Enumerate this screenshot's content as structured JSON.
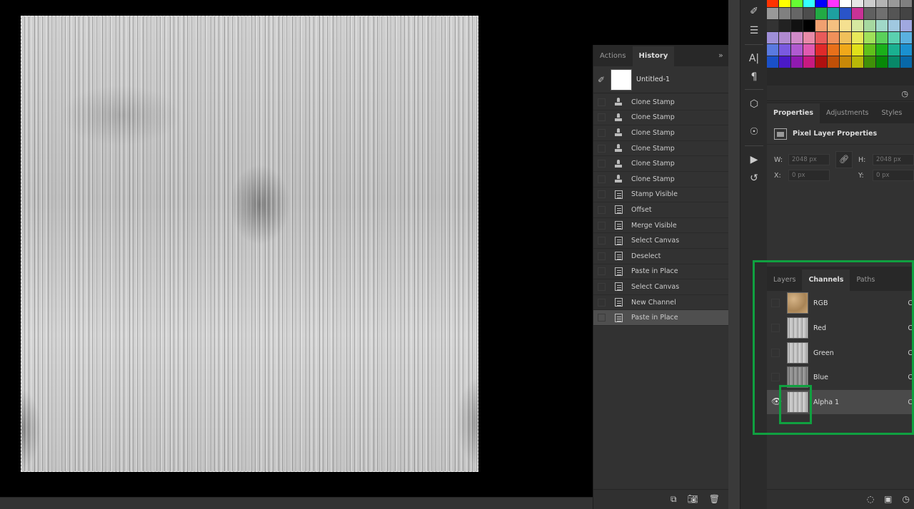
{
  "history_panel": {
    "tabs": [
      "Actions",
      "History"
    ],
    "active_tab": "History",
    "snapshot": "Untitled-1",
    "items": [
      {
        "label": "Clone Stamp",
        "icon": "clone-stamp-icon"
      },
      {
        "label": "Clone Stamp",
        "icon": "clone-stamp-icon"
      },
      {
        "label": "Clone Stamp",
        "icon": "clone-stamp-icon"
      },
      {
        "label": "Clone Stamp",
        "icon": "clone-stamp-icon"
      },
      {
        "label": "Clone Stamp",
        "icon": "clone-stamp-icon"
      },
      {
        "label": "Clone Stamp",
        "icon": "clone-stamp-icon"
      },
      {
        "label": "Stamp Visible",
        "icon": "history-step-icon"
      },
      {
        "label": "Offset",
        "icon": "history-step-icon"
      },
      {
        "label": "Merge Visible",
        "icon": "history-step-icon"
      },
      {
        "label": "Select Canvas",
        "icon": "history-step-icon"
      },
      {
        "label": "Deselect",
        "icon": "history-step-icon"
      },
      {
        "label": "Paste in Place",
        "icon": "history-step-icon"
      },
      {
        "label": "Select Canvas",
        "icon": "history-step-icon"
      },
      {
        "label": "New Channel",
        "icon": "history-step-icon"
      },
      {
        "label": "Paste in Place",
        "icon": "history-step-icon",
        "active": true
      }
    ],
    "footer_icons": [
      "new-document-from-state-icon",
      "snapshot-camera-icon",
      "trash-icon"
    ]
  },
  "properties_panel": {
    "tabs": [
      "Properties",
      "Adjustments",
      "Styles"
    ],
    "active_tab": "Properties",
    "title": "Pixel Layer Properties",
    "w_label": "W:",
    "w_value": "2048 px",
    "h_label": "H:",
    "h_value": "2048 px",
    "x_label": "X:",
    "x_value": "0 px",
    "y_label": "Y:",
    "y_value": "0 px"
  },
  "channels_panel": {
    "tabs": [
      "Layers",
      "Channels",
      "Paths"
    ],
    "active_tab": "Channels",
    "channels": [
      {
        "name": "RGB",
        "shortcut": "C",
        "thumb": "color"
      },
      {
        "name": "Red",
        "shortcut": "C",
        "thumb": "gray"
      },
      {
        "name": "Green",
        "shortcut": "C",
        "thumb": "gray"
      },
      {
        "name": "Blue",
        "shortcut": "C",
        "thumb": "dark"
      },
      {
        "name": "Alpha 1",
        "shortcut": "C",
        "thumb": "gray",
        "active": true,
        "visible": true
      }
    ],
    "footer_icons": [
      "load-selection-icon",
      "save-selection-icon",
      "new-channel-icon"
    ]
  },
  "swatches": [
    "#ff3300",
    "#ffff00",
    "#66ff33",
    "#33ffff",
    "#0000ff",
    "#ff33ff",
    "#ffffff",
    "#e6e6e6",
    "#cccccc",
    "#b3b3b3",
    "#999999",
    "#808080",
    "#999999",
    "#808080",
    "#666666",
    "#4d4d4d",
    "#22aa44",
    "#1ea0a0",
    "#2a54c8",
    "#c83296",
    "#606060",
    "#707070",
    "#555555",
    "#444444",
    "#333333",
    "#222222",
    "#111111",
    "#000000",
    "#f0a070",
    "#f5c080",
    "#f5e090",
    "#d6e8a0",
    "#a6d8a0",
    "#a0d8c8",
    "#a0c8e0",
    "#a0a8e0",
    "#9f8fd8",
    "#b08ad0",
    "#d08ac8",
    "#e88aa8",
    "#e85a5a",
    "#f0905a",
    "#f0c05a",
    "#e8e85a",
    "#a0e05a",
    "#5ad05a",
    "#5ad0b0",
    "#5ab0e0",
    "#5a7ae0",
    "#7a5ae0",
    "#b05ad0",
    "#e05ab0",
    "#e02a2a",
    "#e8701a",
    "#f0a81a",
    "#e0e01a",
    "#60c01a",
    "#1ab01a",
    "#1ab090",
    "#1a90d0",
    "#1a50c8",
    "#4a1ac8",
    "#901ab0",
    "#c81a80",
    "#b01010",
    "#c05008",
    "#c88808",
    "#b8b808",
    "#409008",
    "#088808",
    "#088868",
    "#0868a8"
  ],
  "colors": {
    "panel_bg": "#323232",
    "panel_header": "#282828",
    "highlight_green": "#10a040",
    "active_row": "#4f4f4f"
  }
}
